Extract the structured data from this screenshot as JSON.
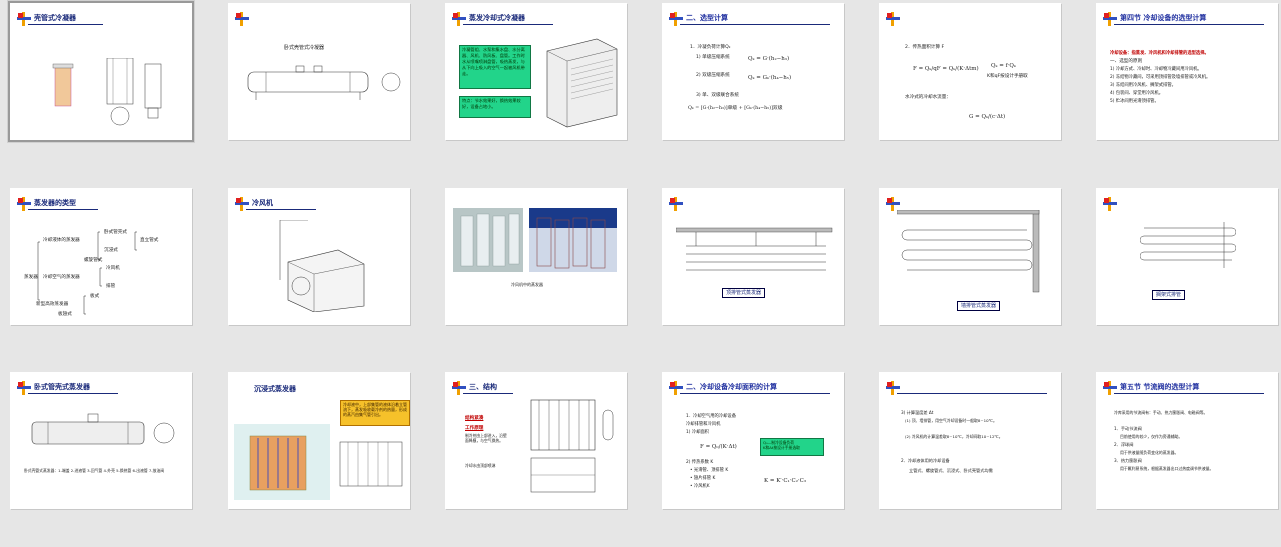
{
  "slides": [
    {
      "title": "壳管式冷凝器"
    },
    {
      "caption": "卧式壳管式冷凝器"
    },
    {
      "title": "蒸发冷却式冷凝器",
      "note1": "冷凝管组、水泵和集水盘、水分离器、风机、防风板、盘管。工作时水从喷嘴喷淋盘管，吸热蒸发，与从下向上吸入的空气一起被风机带走。",
      "note2": "特点：节水效果好，换热效果较好，设备占地小。"
    },
    {
      "title": "二、选型计算",
      "l1": "1．冷凝负荷计算Qₖ",
      "l2": "1) 单级压缩系统",
      "l3": "2) 双级压缩系统",
      "l4": "3) 单、双级联合系统",
      "f1": "Qₖ = G·(h₂−h₃)",
      "f2": "Qₖ = Gₖ·(h₄−h₅)",
      "f3": "Qₖ = [G·(h₂−h₃)]单级 + [Gₖ·(h₄−h₅)]双级"
    },
    {
      "l1": "2．传热面积计算 F",
      "f1": "F = Qₖ/qF = Qₖ/(K·Δtm)",
      "f2": "Qₖ = f·Qₖ",
      "f3": "K和qF按设计手册取",
      "l2": "水冷式的冷却水流量：",
      "f4": "G = Qₖ/(c·Δt)"
    },
    {
      "title": "第四节  冷却设备的选型计算",
      "l0": "冷却设备：指蒸发、冷风机和冷却排管的选型选择。",
      "l1": "一、选型的原则",
      "l2": "1) 冷却方式、冷却时、冷却物冷藏间用冷风机。",
      "l3": "2) 冻结物冷藏间，可采用顶排管及墙排管或冷风机。",
      "l4": "3) 冻结间用冷风机、搁架式排管。",
      "l5": "4) 包装间、穿堂用冷风机。",
      "l6": "5) 贮冰间用光滑顶排管。"
    },
    {
      "title": "蒸发器的类型",
      "t1": "冷却液体的蒸发器",
      "t2": "卧式管壳式",
      "t3": "直立管式",
      "t4": "沉浸式",
      "t5": "螺旋管式",
      "t6": "蒸发器",
      "t7": "冷却空气的蒸发器",
      "t8": "冷风机",
      "t9": "排管",
      "t10": "新型高效蒸发器",
      "t11": "板式",
      "t12": "板翅式"
    },
    {
      "title": "冷风机"
    },
    {
      "caption": "冷风机中的蒸发器"
    },
    {
      "label": "顶排管式蒸发器"
    },
    {
      "label": "墙排管式蒸发器"
    },
    {
      "label": "搁架式排管"
    },
    {
      "title": "卧式管壳式蒸发器",
      "cap": "卧式壳管式蒸发器：1-端盖 2-进液管 3-回气管 4-外壳 5-换热管 6-出液管 7-放油阀"
    },
    {
      "title": "沉浸式蒸发器",
      "note": "冷却液中，上部集管的液体沿着立管流下，蒸发吸收载冷剂的热量，形成的蒸汽由集气管引出。"
    },
    {
      "title": "三、结构",
      "b1": "结构紧凑",
      "b2": "工作原理",
      "b3": "制冷剂由上部进入，沿壁面降膜，与空气换热。",
      "b4": "冷却水由顶部喷淋"
    },
    {
      "title": "二、冷却设备冷却面积的计算",
      "l1": "1．冷却空气用的冷却设备",
      "l2": "冷却排管和冷风机",
      "l3": "1) 冷却面积",
      "l4": "2) 传热系数 K",
      "l5": "• 光滑管、顶排管 K",
      "l6": "• 翅片排管 K",
      "l7": "• 冷风机K",
      "g1": "Q₀—制冷设备负荷",
      "g2": "K和Δt按设计手册选取",
      "f1": "F = Q₀/(K·Δt)",
      "f2": "K = K′·C₁·C₂·C₃"
    },
    {
      "l1": "3) 计算温度差 Δt",
      "l2": "(1) 顶、墙排管，用空气冷却设备时一般取8~10℃。",
      "l3": "(2) 冷风机的计算温差取8~10℃，冷却间取10~12℃。",
      "l4": "2．冷却液体用的冷却设备",
      "l5": "立管式、螺旋管式、沉浸式、卧式壳管式均需",
      "l6": ""
    },
    {
      "title": "第五节  节流阀的选型计算",
      "l0": "冷库采用的节流阀有：手动、热力膨胀阀、电磁阀等。",
      "l1": "1．手动节流阀",
      "l2": "目前使用的较少，仅作为旁通辅助。",
      "l3": "2．浮球阀",
      "l4": "用于供液量随负荷变化的蒸发器。",
      "l5": "3．热力膨胀阀",
      "l6": "用于氟利昂系统，根据蒸发器出口过热度调节供液量。"
    }
  ],
  "colors": {
    "title": "#1a2a7a",
    "green": "#22d48a",
    "orange": "#f6c12a",
    "red": "#c00000"
  }
}
